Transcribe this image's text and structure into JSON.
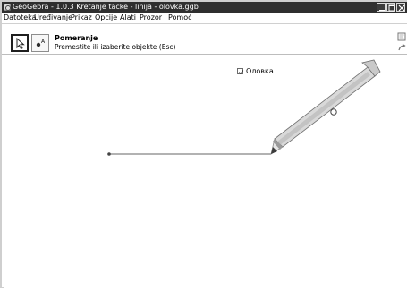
{
  "window": {
    "title": "GeoGebra - 1.0.3 Kretanje tacke - linija - olovka.ggb"
  },
  "menu": {
    "items": [
      "Datoteka",
      "Uređivanje",
      "Prikaz",
      "Opcije",
      "Alati",
      "Prozor",
      "Pomoć"
    ]
  },
  "toolbar": {
    "active_tool_name": "Pomeranje",
    "active_tool_help": "Premestite ili izaberite objekte (Esc)"
  },
  "canvas": {
    "checkbox_label": "Олoвка",
    "checkbox_checked": true
  },
  "colors": {
    "titlebar": "#2f2f2f",
    "pencil_body": "#d9d9d9",
    "pencil_dark": "#8a8a8a",
    "line": "#666666"
  }
}
